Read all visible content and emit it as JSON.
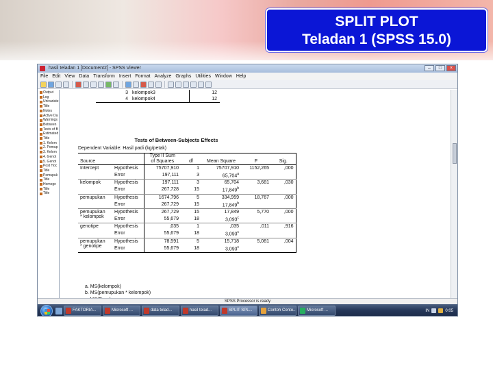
{
  "slide_title": {
    "line1": "SPLIT PLOT",
    "line2": "Teladan 1 (SPSS 15.0)"
  },
  "window": {
    "title": "hasil teladan 1 [Document2] - SPSS Viewer",
    "controls": [
      "–",
      "□",
      "×"
    ],
    "menu": [
      "File",
      "Edit",
      "View",
      "Data",
      "Transform",
      "Insert",
      "Format",
      "Analyze",
      "Graphs",
      "Utilities",
      "Window",
      "Help"
    ],
    "status": "SPSS Processor is ready"
  },
  "outline": [
    "Output",
    "Log",
    "Univariate",
    "Title",
    "Notes",
    "Active Da",
    "Warnings",
    "Between",
    "Tests of B",
    "Estimated",
    "Title",
    "1. Kelom",
    "2. Pemup",
    "3. Kelom",
    "4. Genot",
    "5. Genot",
    "Post Hoc",
    "Title",
    "Pemupuk",
    "Title",
    "Homoge",
    "Title",
    "Title"
  ],
  "top_table": {
    "rows": [
      {
        "idx": "3",
        "label": "kelompok3",
        "n": "12"
      },
      {
        "idx": "4",
        "label": "kelompok4",
        "n": "12"
      }
    ]
  },
  "main_table": {
    "title": "Tests of Between-Subjects Effects",
    "dependent": "Dependent Variable: Hasil padi (kg/petak)",
    "headers": {
      "source": "Source",
      "ss_line1": "Type II Sum",
      "ss_line2": "of Squares",
      "df": "df",
      "ms": "Mean Square",
      "f": "F",
      "sig": "Sig."
    },
    "rows": [
      {
        "source": "Intercept",
        "source2": "",
        "type": "Hypothesis",
        "ss": "75707,910",
        "df": "1",
        "ms": "75707,910",
        "sup": "",
        "f": "1152,265",
        "sig": ",000"
      },
      {
        "source": "",
        "source2": "",
        "type": "Error",
        "ss": "197,111",
        "df": "3",
        "ms": "65,704",
        "sup": "a",
        "f": "",
        "sig": ""
      },
      {
        "source": "kelompok",
        "source2": "",
        "type": "Hypothesis",
        "ss": "197,111",
        "df": "3",
        "ms": "65,704",
        "sup": "",
        "f": "3,681",
        "sig": ",030"
      },
      {
        "source": "",
        "source2": "",
        "type": "Error",
        "ss": "267,728",
        "df": "15",
        "ms": "17,849",
        "sup": "b",
        "f": "",
        "sig": ""
      },
      {
        "source": "pemupukan",
        "source2": "",
        "type": "Hypothesis",
        "ss": "1674,796",
        "df": "5",
        "ms": "334,959",
        "sup": "",
        "f": "18,767",
        "sig": ",000"
      },
      {
        "source": "",
        "source2": "",
        "type": "Error",
        "ss": "267,729",
        "df": "15",
        "ms": "17,849",
        "sup": "b",
        "f": "",
        "sig": ""
      },
      {
        "source": "pemupukan",
        "source2": "* kelompok",
        "type": "Hypothesis",
        "ss": "267,729",
        "df": "15",
        "ms": "17,849",
        "sup": "",
        "f": "5,770",
        "sig": ",000"
      },
      {
        "source": "",
        "source2": "",
        "type": "Error",
        "ss": "55,679",
        "df": "18",
        "ms": "3,093",
        "sup": "c",
        "f": "",
        "sig": ""
      },
      {
        "source": "genotipe",
        "source2": "",
        "type": "Hypothesis",
        "ss": ",035",
        "df": "1",
        "ms": ",035",
        "sup": "",
        "f": ",011",
        "sig": ",916"
      },
      {
        "source": "",
        "source2": "",
        "type": "Error",
        "ss": "55,679",
        "df": "18",
        "ms": "3,093",
        "sup": "c",
        "f": "",
        "sig": ""
      },
      {
        "source": "pemupukan",
        "source2": "* genotipe",
        "type": "Hypothesis",
        "ss": "78,591",
        "df": "5",
        "ms": "15,718",
        "sup": "",
        "f": "5,081",
        "sig": ",004"
      },
      {
        "source": "",
        "source2": "",
        "type": "Error",
        "ss": "55,679",
        "df": "18",
        "ms": "3,093",
        "sup": "c",
        "f": "",
        "sig": ""
      }
    ],
    "notes": [
      "a.  MS(kelompok)",
      "b.  MS(pemupukan * kelompok)",
      "c.  MS(Error)"
    ]
  },
  "taskbar": {
    "tasks": [
      {
        "label": "FAKTORIA...",
        "color": "#c0392b"
      },
      {
        "label": "Microsoft ...",
        "color": "#c0392b"
      },
      {
        "label": "data telad...",
        "color": "#c0392b"
      },
      {
        "label": "hasil telad...",
        "color": "#c0392b"
      },
      {
        "label": "SPLIT SPL...",
        "color": "#c0392b"
      },
      {
        "label": "Contoh Conto...",
        "color": "#e6a23c"
      },
      {
        "label": "Microsoft ...",
        "color": "#27ae60"
      }
    ],
    "lang": "IN",
    "clock": "0:05"
  }
}
